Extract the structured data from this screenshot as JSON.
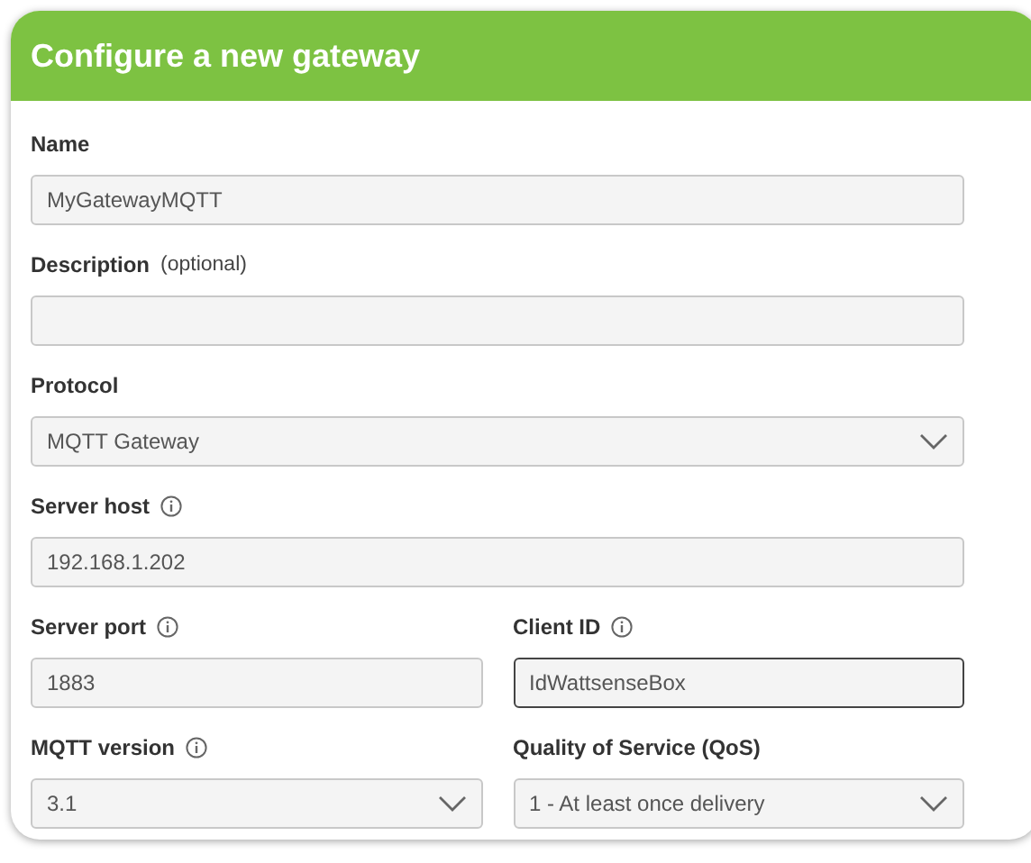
{
  "dialog": {
    "title": "Configure a new gateway"
  },
  "rows": [
    {
      "fields": [
        {
          "kind": "text",
          "label": "Name",
          "info": false,
          "value": "MyGatewayMQTT",
          "focused": false
        }
      ]
    },
    {
      "fields": [
        {
          "kind": "text",
          "label": "Description",
          "note": "(optional)",
          "info": false,
          "focused": false
        }
      ]
    },
    {
      "fields": [
        {
          "kind": "select",
          "label": "Protocol",
          "info": false,
          "value": "MQTT Gateway",
          "focused": false
        }
      ]
    },
    {
      "fields": [
        {
          "kind": "text",
          "label": "Server host",
          "info": true,
          "value": "192.168.1.202",
          "focused": false
        }
      ]
    },
    {
      "fields": [
        {
          "kind": "text",
          "label": "Server port",
          "info": true,
          "value": "1883",
          "focused": false
        },
        {
          "kind": "text",
          "label": "Client ID",
          "info": true,
          "value": "IdWattsenseBox",
          "focused": true
        }
      ]
    },
    {
      "fields": [
        {
          "kind": "select",
          "label": "MQTT version",
          "info": true,
          "value": "3.1",
          "focused": false
        },
        {
          "kind": "select",
          "label": "Quality of Service (QoS)",
          "info": false,
          "value": "1 - At least once delivery",
          "focused": false
        }
      ]
    }
  ]
}
